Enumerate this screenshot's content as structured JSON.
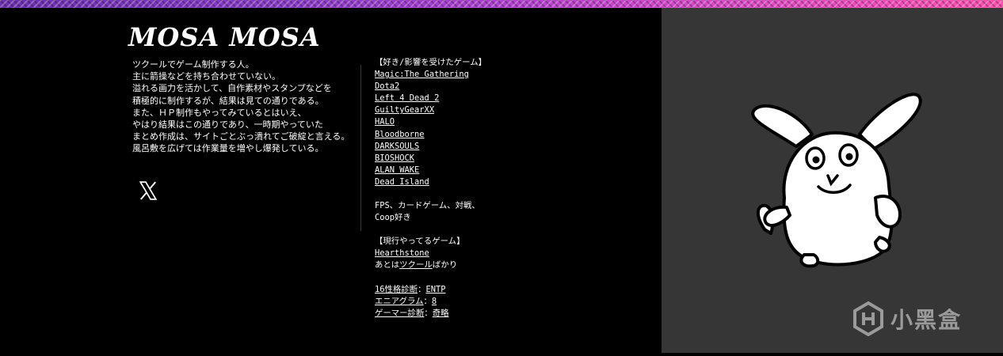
{
  "header": {
    "title": "MOSA MOSA"
  },
  "bio": {
    "lines": [
      "ツクールでゲーム制作する人。",
      "主に箭操などを持ち合わせていない。",
      "溢れる画力を活かして、自作素材やスタンプなどを",
      "積極的に制作するが、結果は見ての通りである。",
      "また、ＨＰ制作もやってみているとはいえ、",
      "やはり結果はこの通りであり、一時期やっていた",
      "まとめ作成は、サイトごとぶっ潰れてご破綻と言える。",
      "風呂敷を広げては作業量を増やし爆発している。"
    ]
  },
  "social": {
    "x_icon": "x-logo-icon"
  },
  "games": {
    "favorites_heading": "【好き/影響を受けたゲーム】",
    "favorites": [
      "Magic:The Gathering",
      "Dota2",
      "Left 4 Dead 2",
      "GuiltyGearXX",
      "HALO",
      "Bloodborne",
      "DARKSOULS",
      "BIOSHOCK",
      "ALAN WAKE",
      "Dead Island"
    ],
    "genres_line1": "FPS、カードゲーム、対戦、",
    "genres_line2": "Coop好き",
    "current_heading": "【現行やってるゲーム】",
    "current_game": "Hearthstone",
    "current_rest_prefix": "あとは",
    "current_rest_link": "ツクール",
    "current_rest_suffix": "ばかり",
    "personality": {
      "mbti_label": "16性格診断",
      "mbti_value": "ENTP",
      "enneagram_label": "エニアグラム",
      "enneagram_value": "8",
      "gamer_label": "ゲーマー診断",
      "gamer_value": "奇略",
      "sep": "："
    }
  },
  "watermark": {
    "text": "小黑盒"
  },
  "colors": {
    "accent_band": "#b03fd0",
    "panel_bg": "#363636"
  }
}
